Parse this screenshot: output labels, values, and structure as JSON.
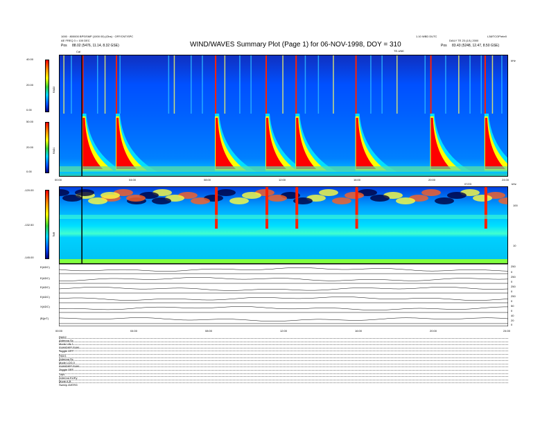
{
  "header": {
    "title": "WIND/WAVES Summary Plot (Page 1) for 06-NOV-1998, DOY = 310",
    "left_line1": "1000 · 800000 BPS/SMP (1000 00) (Obs) · OFF/CNT/SPC",
    "left_line2": "AE FREQ 3 = 100 DEC",
    "left_pos_label": "Pos",
    "left_pos_value": "88.02 (5476, 11.14, 8.32 GSE)",
    "right_line1": "1.10 WBD DUTC",
    "right_line1b": "L38/TCOP/ebr0",
    "right_line2": "DAILY TE 23 (1/1) 2000",
    "right_pos_label": "Pos",
    "right_pos_value": "83.43 (5248, 12.47, 8.50 GSE)",
    "mid_marker": "TE-UNK",
    "left_marker": "Cal",
    "right_top_label": "kHz"
  },
  "rad2": {
    "label": "RAD2",
    "ticks": [
      "40.00",
      "20.00",
      "0.00"
    ]
  },
  "rad1": {
    "label": "RAD1",
    "ticks": [
      "50.00",
      "20.00",
      "0.00"
    ]
  },
  "tnr": {
    "label": "TNR",
    "ticks": [
      "-120.00",
      "-132.50",
      "-145.00"
    ],
    "right_ticks": [
      "100",
      "10"
    ],
    "top_right": "07/23",
    "top_right_marker": "kHz"
  },
  "time_axis": {
    "ticks": [
      "00:00",
      "04:00",
      "08:00",
      "12:00",
      "16:00",
      "20:00",
      "24:00"
    ]
  },
  "traces": [
    {
      "label": "E(ADC)",
      "right": [
        "250",
        "0"
      ]
    },
    {
      "label": "E(ADC)",
      "right": [
        "250",
        "0"
      ]
    },
    {
      "label": "E(ADC)",
      "right": [
        "250",
        "0"
      ]
    },
    {
      "label": "E(ADC)",
      "right": [
        "250",
        "0"
      ]
    },
    {
      "label": "X(ADC)",
      "right": [
        "50",
        "0"
      ]
    },
    {
      "label": "|B|(nT)",
      "right": [
        "40",
        "20",
        "0"
      ]
    }
  ],
  "footer": {
    "rows": [
      "RAD2",
      "Antenna    Sx",
      "Mode    LIN 1",
      "SUM/DIFF SUM",
      "Toggle    OFF",
      "RAD1",
      "Antenna    Sx",
      "Mode    LOG 0",
      "SUM/DIFF SUM",
      "Toggle    OFF",
      "TNR",
      "Antenna    Ex/Ey",
      "Mode    A-B",
      "Sweep  AVERG"
    ]
  },
  "chart_data": {
    "type": "heatmap",
    "title": "WIND/WAVES Summary Plot (Page 1) for 06-NOV-1998, DOY = 310",
    "x_ticks": [
      "00:00",
      "04:00",
      "08:00",
      "12:00",
      "16:00",
      "20:00",
      "24:00"
    ],
    "panels": [
      {
        "name": "RAD2",
        "colorbar": [
          0,
          40
        ],
        "ticks": [
          "40.00",
          "20.00",
          "0.00"
        ]
      },
      {
        "name": "RAD1",
        "colorbar": [
          0,
          50
        ],
        "ticks": [
          "50.00",
          "20.00",
          "0.00"
        ]
      },
      {
        "name": "TNR",
        "colorbar": [
          -145,
          -120
        ],
        "ticks": [
          "-120.00",
          "-132.50",
          "-145.00"
        ]
      }
    ],
    "bursts_hours": [
      1.2,
      3.0,
      8.3,
      11.0,
      12.6,
      15.8,
      19.8,
      22.7
    ],
    "colors": {
      "high": "#ff0000",
      "mid": "#ffff00",
      "low": "#00d0ff",
      "bg": "#0050ff"
    }
  }
}
